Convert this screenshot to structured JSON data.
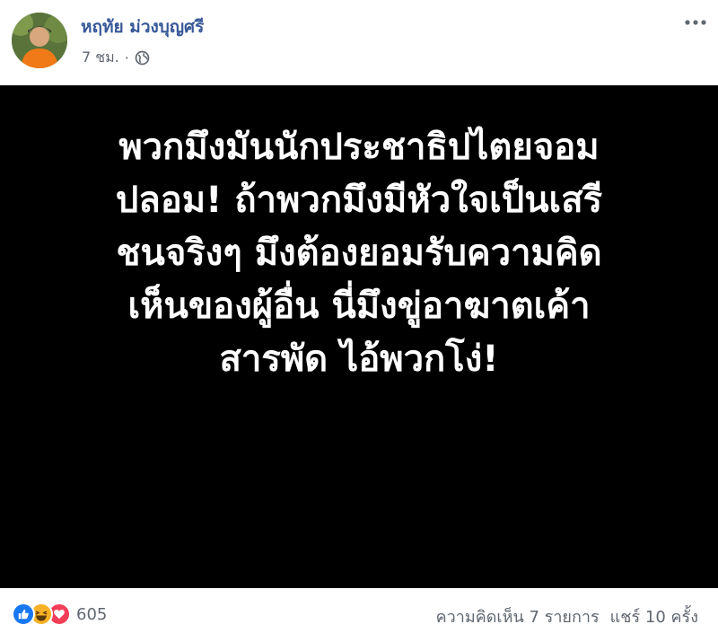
{
  "post": {
    "author": "หฤทัย ม่วงบุญศรี",
    "time": "7 ชม.",
    "separator": "·",
    "privacy_icon": "globe-icon",
    "more_icon": "more-horizontal-icon",
    "image_text_lines": [
      "พวกมึงมันนักประชาธิปไตยจอม",
      "ปลอม! ถ้าพวกมึงมีหัวใจเป็นเสรี",
      "ชนจริงๆ มึงต้องยอมรับความคิด",
      "เห็นของผู้อื่น นี่มึงขู่อาฆาตเค้า",
      "สารพัด ไอ้พวกโง่!"
    ]
  },
  "footer": {
    "reaction_icons": [
      "like-icon",
      "haha-icon",
      "love-icon"
    ],
    "reaction_count": "605",
    "comments": "ความคิดเห็น 7 รายการ",
    "shares": "แชร์ 10 ครั้ง"
  },
  "colors": {
    "author": "#385898",
    "meta": "#616770",
    "image_background": "#000000",
    "like": "#1877f2",
    "haha": "#f7b125",
    "love": "#f33e58"
  }
}
